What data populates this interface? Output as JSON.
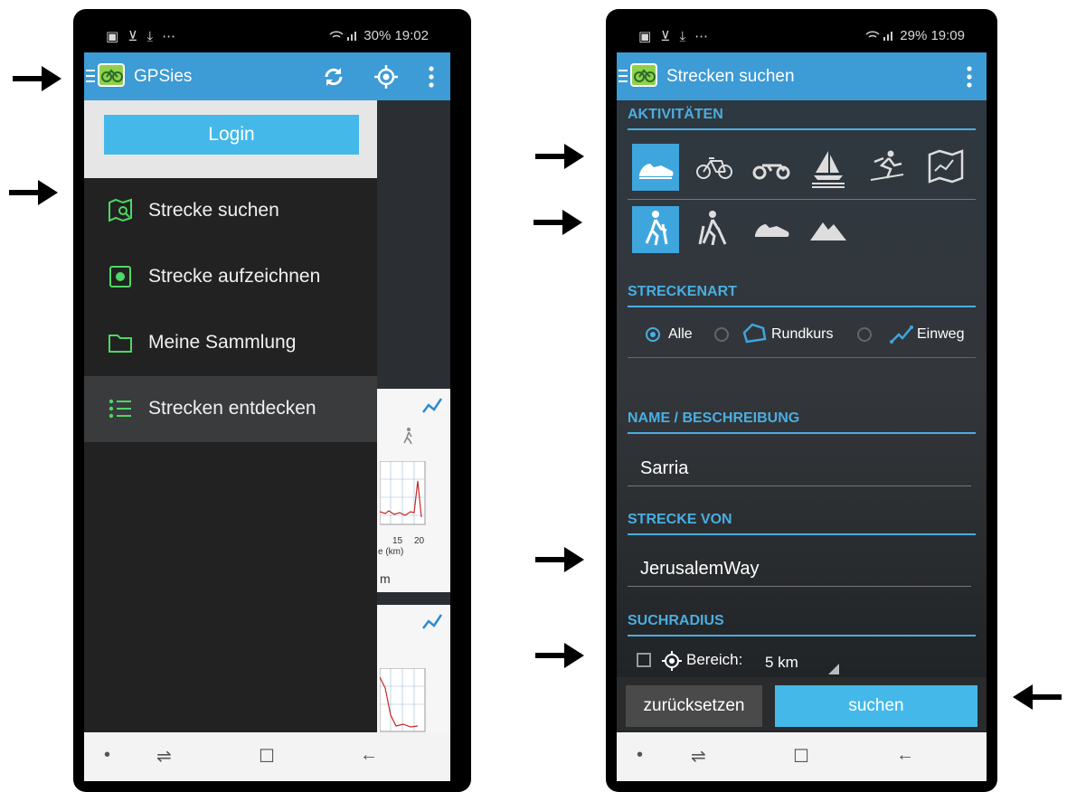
{
  "left_phone": {
    "status": {
      "left_icons": "▣ ⊻ ⤓ ⋯",
      "right": "30% 19:02"
    },
    "appbar": {
      "title": "GPSies"
    },
    "drawer": {
      "login_label": "Login",
      "items": [
        {
          "label": "Strecke suchen",
          "icon": "map-search-icon"
        },
        {
          "label": "Strecke aufzeichnen",
          "icon": "record-icon"
        },
        {
          "label": "Meine Sammlung",
          "icon": "folder-icon"
        },
        {
          "label": "Strecken entdecken",
          "icon": "list-icon"
        }
      ]
    },
    "map_peek": {
      "axis_ticks": [
        "15",
        "20"
      ],
      "axis_label": "e (km)",
      "unit_label": "m"
    }
  },
  "right_phone": {
    "status": {
      "left_icons": "▣ ⊻ ⤓ ⋯",
      "right": "29% 19:09"
    },
    "appbar": {
      "title": "Strecken suchen"
    },
    "sections": {
      "activities": "AKTIVITÄTEN",
      "route_type": "STRECKENART",
      "name": "NAME / BESCHREIBUNG",
      "route_from": "STRECKE VON",
      "radius": "SUCHRADIUS"
    },
    "activities": [
      "running-shoe-icon",
      "bicycle-icon",
      "motorcycle-icon",
      "sailboat-icon",
      "ski-icon",
      "map-icon"
    ],
    "sub_activities": [
      "hiking-icon",
      "nordic-walking-icon",
      "running-shoe-icon",
      "mountain-icon"
    ],
    "route_types": [
      {
        "label": "Alle",
        "selected": true
      },
      {
        "label": "Rundkurs",
        "selected": false
      },
      {
        "label": "Einweg",
        "selected": false
      }
    ],
    "name_value": "Sarria",
    "route_from_value": "JerusalemWay",
    "radius": {
      "label": "Bereich:",
      "value": "5 km",
      "checked": false
    },
    "buttons": {
      "reset": "zurücksetzen",
      "search": "suchen"
    }
  },
  "nav_icons": {
    "dot": "•",
    "recents": "⇌",
    "home": "☐",
    "back": "←"
  },
  "colors": {
    "accent": "#3d9bd6",
    "drawer_icon": "#4cd964",
    "button_blue": "#44b9e9"
  }
}
